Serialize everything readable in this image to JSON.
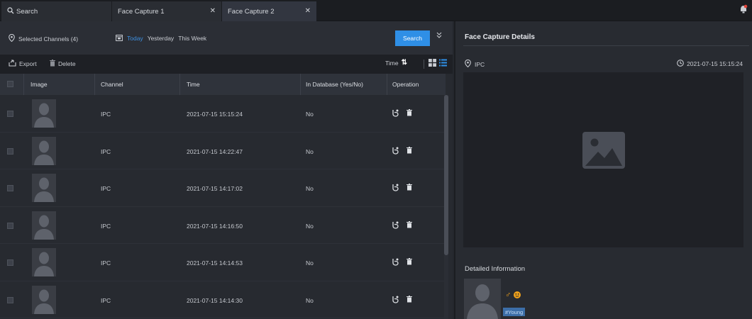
{
  "tabs": [
    {
      "label": "Search",
      "icon": "search-icon"
    },
    {
      "label": "Face Capture 1"
    },
    {
      "label": "Face Capture 2",
      "active": true
    }
  ],
  "filter": {
    "channels_label": "Selected Channels (4)",
    "date_options": [
      "Today",
      "Yesterday",
      "This Week"
    ],
    "selected_date": "Today",
    "search_label": "Search"
  },
  "toolbar": {
    "export_label": "Export",
    "delete_label": "Delete",
    "sort_label": "Time"
  },
  "table": {
    "headers": [
      "Image",
      "Channel",
      "Time",
      "In Database (Yes/No)",
      "Operation"
    ],
    "rows": [
      {
        "channel": "IPC",
        "time": "2021-07-15 15:15:24",
        "in_db": "No"
      },
      {
        "channel": "IPC",
        "time": "2021-07-15 14:22:47",
        "in_db": "No"
      },
      {
        "channel": "IPC",
        "time": "2021-07-15 14:17:02",
        "in_db": "No"
      },
      {
        "channel": "IPC",
        "time": "2021-07-15 14:16:50",
        "in_db": "No"
      },
      {
        "channel": "IPC",
        "time": "2021-07-15 14:14:53",
        "in_db": "No"
      },
      {
        "channel": "IPC",
        "time": "2021-07-15 14:14:30",
        "in_db": "No"
      }
    ]
  },
  "details": {
    "title": "Face Capture Details",
    "location": "IPC",
    "timestamp": "2021-07-15 15:15:24",
    "info_title": "Detailed Information",
    "tag": "#Young"
  },
  "colors": {
    "accent": "#2f8fe6",
    "attribute": "#f1a21b",
    "tag_bg": "#3c6ea8"
  }
}
